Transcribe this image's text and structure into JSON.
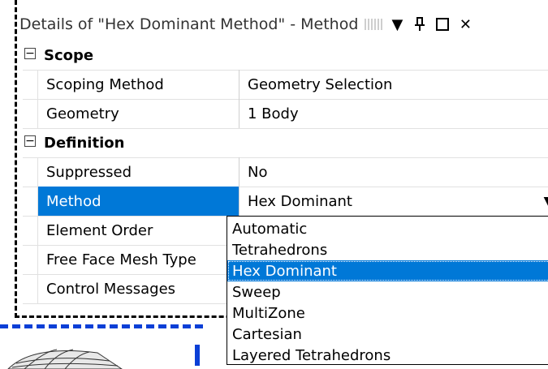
{
  "window": {
    "title": "Details of \"Hex Dominant Method\" - Method",
    "controls": {
      "pin": "pin-icon",
      "dropdown": "chevron-down-icon",
      "maximize": "maximize-icon",
      "close": "close-icon"
    }
  },
  "sections": [
    {
      "label": "Scope",
      "collapse_symbol": "−"
    },
    {
      "label": "Definition",
      "collapse_symbol": "−"
    }
  ],
  "rows": {
    "scoping_method": {
      "name": "Scoping Method",
      "value": "Geometry Selection"
    },
    "geometry": {
      "name": "Geometry",
      "value": "1 Body"
    },
    "suppressed": {
      "name": "Suppressed",
      "value": "No"
    },
    "method": {
      "name": "Method",
      "value": "Hex Dominant"
    },
    "element_order": {
      "name": "Element Order"
    },
    "free_face": {
      "name": "Free Face Mesh Type"
    },
    "control_messages": {
      "name": "Control Messages"
    }
  },
  "dropdown": {
    "options": [
      "Automatic",
      "Tetrahedrons",
      "Hex Dominant",
      "Sweep",
      "MultiZone",
      "Cartesian",
      "Layered Tetrahedrons"
    ],
    "selected_index": 2
  },
  "colors": {
    "selection": "#0078d7",
    "annotation_blue": "#0b3fd6"
  }
}
